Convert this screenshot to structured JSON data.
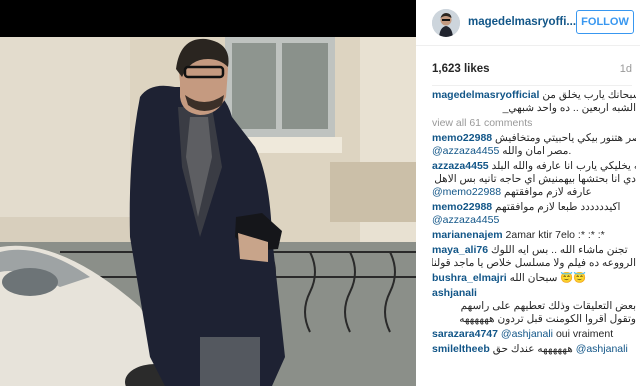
{
  "post": {
    "username": "magedelmasryofficial",
    "header_username": "magedelmasryoffi...",
    "follow_label": "FOLLOW",
    "likes": "1,623 likes",
    "age": "1d"
  },
  "caption": {
    "user": "magedelmasryofficial",
    "text_1": "سبحانك يارب يخلق من",
    "text_2": "الشبه اربعين .. ده واحد شبهي_"
  },
  "view_all": "view all 61 comments",
  "comments": [
    {
      "user": "memo22988",
      "line1": "مصر هتنور بيكي ياحبيتي ومتخافيش",
      "line2": ".مصر امان والله",
      "mention": "@azzaza4455"
    },
    {
      "user": "azzaza4455",
      "line1": "الله يخليكي يارب انا عارفه والله البلد",
      "line2": "دي انا بحتشها بيهمنيش اي حاجه تانيه بس الاهل انتي",
      "line3": "عارفه لازم موافقتهم",
      "mention": "@memo22988"
    },
    {
      "user": "memo22988",
      "line1": "اكيدددددد طبعا لازم موافقتهم",
      "mention": "@azzaza4455"
    },
    {
      "user": "marianenajem",
      "text": "2amar ktir 7elo :* :* :*"
    },
    {
      "user": "maya_ali76",
      "line1": "تجنن ماشاء الله .. بس ايه اللوك",
      "line2": "الرووعه ده فيلم ولا مسلسل خلاص يا ماجد قولنا بقه"
    },
    {
      "user": "bushra_elmajri",
      "text": "سبحان الله 😇😇"
    },
    {
      "user": "ashjanali",
      "line1": "بعض التعليقات وذلك تعطيهم على راسهم",
      "line2": "وتقول أقروا الكومنت قبل تردون ههههههه"
    },
    {
      "user": "sarazara4747",
      "mention": "@ashjanali",
      "text": "oui vraiment"
    },
    {
      "user": "smileltheeb",
      "text": "ههههههه عندك حق",
      "mention": "@ashjanali"
    }
  ]
}
